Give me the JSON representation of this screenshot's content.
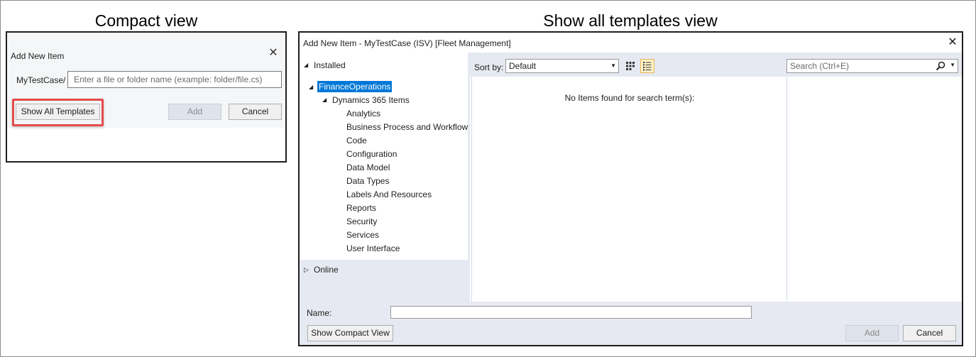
{
  "captions": {
    "compact": "Compact view",
    "full": "Show all templates view"
  },
  "compact_dialog": {
    "title": "Add New Item",
    "path_prefix": "MyTestCase/",
    "path_placeholder": "Enter a file or folder name (example: folder/file.cs)",
    "show_all_label": "Show All Templates",
    "add_label": "Add",
    "cancel_label": "Cancel"
  },
  "full_dialog": {
    "title": "Add New Item - MyTestCase (ISV) [Fleet Management]",
    "tree": {
      "installed": "Installed",
      "finance_operations": "FinanceOperations",
      "dynamics_items": "Dynamics 365 Items",
      "categories": [
        "Analytics",
        "Business Process and Workflow",
        "Code",
        "Configuration",
        "Data Model",
        "Data Types",
        "Labels And Resources",
        "Reports",
        "Security",
        "Services",
        "User Interface"
      ],
      "online": "Online"
    },
    "sort_by_label": "Sort by:",
    "sort_value": "Default",
    "search_placeholder": "Search (Ctrl+E)",
    "empty_message": "No Items found for search term(s):",
    "name_label": "Name:",
    "name_value": "",
    "show_compact_label": "Show Compact View",
    "add_label": "Add",
    "cancel_label": "Cancel"
  },
  "colors": {
    "highlight_border": "#e34a4a",
    "selection": "#0078d7",
    "pane_background": "#e6e9f1"
  }
}
